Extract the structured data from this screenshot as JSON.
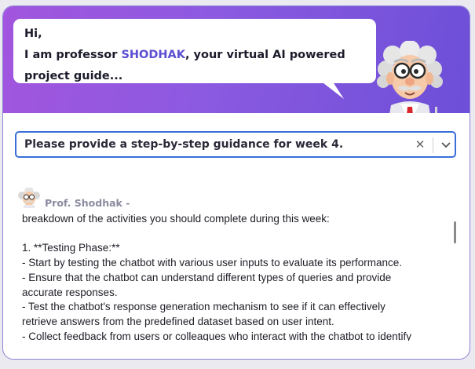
{
  "greeting": {
    "line1": "Hi,",
    "line2_prefix": "I am professor ",
    "name": "SHODHAK",
    "line2_suffix": ", your virtual AI powered",
    "line3": "project guide..."
  },
  "query_select": {
    "value": "Please provide a step-by-step guidance for week 4.",
    "clear_glyph": "✕"
  },
  "response": {
    "author": "Prof. Shodhak -",
    "lines": [
      "breakdown of the activities you should complete during this week:",
      "",
      "1. **Testing Phase:**",
      "- Start by testing the chatbot with various user inputs to evaluate its performance.",
      "- Ensure that the chatbot can understand different types of queries and provide",
      "accurate responses.",
      "- Test the chatbot's response generation mechanism to see if it can effectively",
      "retrieve answers from the predefined dataset based on user intent.",
      "- Collect feedback from users or colleagues who interact with the chatbot to identify"
    ]
  },
  "colors": {
    "header_start": "#a255de",
    "header_end": "#6d4fd8",
    "name_highlight": "#5b4fd2",
    "select_border": "#3a6fd8"
  },
  "icons": [
    "professor-mascot-icon",
    "professor-avatar-icon",
    "clear-icon",
    "chevron-down-icon"
  ]
}
